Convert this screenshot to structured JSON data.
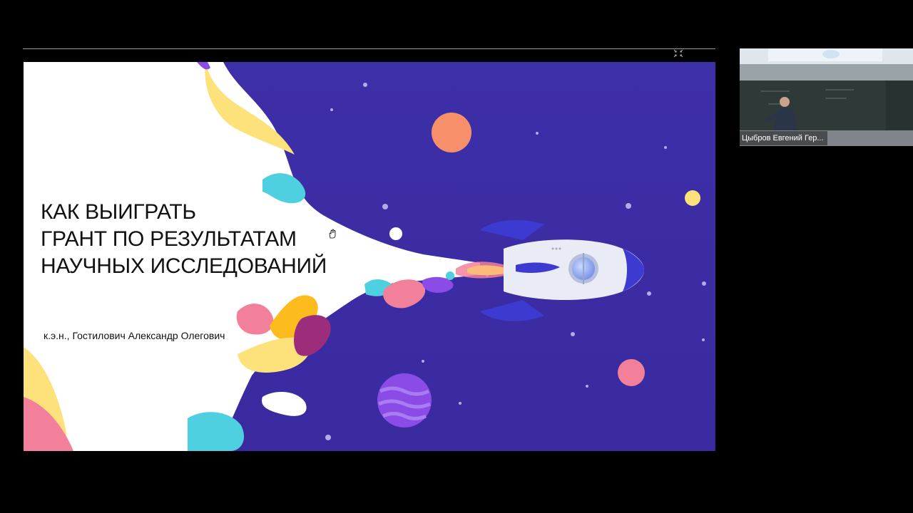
{
  "slide": {
    "title_lines": [
      "КАК ВЫИГРАТЬ",
      "ГРАНТ ПО РЕЗУЛЬТАТАМ",
      "НАУЧНЫХ ИССЛЕДОВАНИЙ"
    ],
    "author": "к.э.н., Гостилович Александр Олегович"
  },
  "participant": {
    "name": "Цыбров Евгений Гер..."
  },
  "icons": {
    "exit_fullscreen": "collapse-arrows-icon",
    "cursor": "hand-cursor-icon",
    "rocket": "rocket-icon"
  },
  "colors": {
    "space": "#3b2fa6",
    "rocket_blue": "#3c3ad0",
    "planet_orange": "#f7906a",
    "planet_pink": "#f2809a",
    "planet_yellow": "#fde17a",
    "planet_purple": "#8a4be6"
  }
}
